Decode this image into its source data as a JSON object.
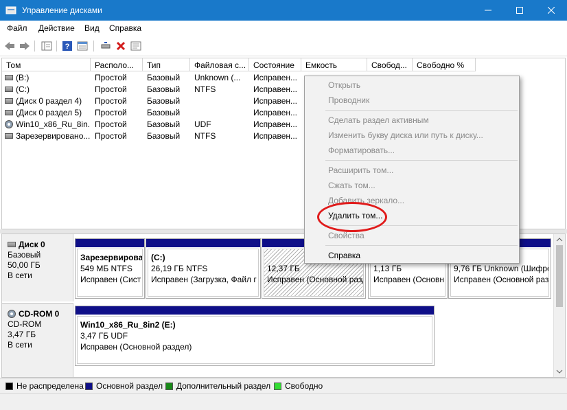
{
  "window": {
    "title": "Управление дисками"
  },
  "menu": {
    "file": "Файл",
    "action": "Действие",
    "view": "Вид",
    "help": "Справка"
  },
  "columns": [
    "Том",
    "Располо...",
    "Тип",
    "Файловая с...",
    "Состояние",
    "Емкость",
    "Свобод...",
    "Свободно %"
  ],
  "volumes": [
    {
      "name": "(B:)",
      "layout": "Простой",
      "type": "Базовый",
      "fs": "Unknown (...",
      "status": "Исправен..."
    },
    {
      "name": "(C:)",
      "layout": "Простой",
      "type": "Базовый",
      "fs": "NTFS",
      "status": "Исправен..."
    },
    {
      "name": "(Диск 0 раздел 4)",
      "layout": "Простой",
      "type": "Базовый",
      "fs": "",
      "status": "Исправен..."
    },
    {
      "name": "(Диск 0 раздел 5)",
      "layout": "Простой",
      "type": "Базовый",
      "fs": "",
      "status": "Исправен..."
    },
    {
      "name": "Win10_x86_Ru_8in...",
      "layout": "Простой",
      "type": "Базовый",
      "fs": "UDF",
      "status": "Исправен..."
    },
    {
      "name": "Зарезервировано...",
      "layout": "Простой",
      "type": "Базовый",
      "fs": "NTFS",
      "status": "Исправен..."
    }
  ],
  "disks": [
    {
      "name": "Диск 0",
      "kind": "Базовый",
      "size": "50,00 ГБ",
      "state": "В сети",
      "partitions": [
        {
          "title": "Зарезервирова",
          "size": "549 МБ NTFS",
          "status": "Исправен (Сист"
        },
        {
          "title": "(C:)",
          "size": "26,19 ГБ NTFS",
          "status": "Исправен (Загрузка, Файл г"
        },
        {
          "title": "",
          "size": "12,37 ГБ",
          "status": "Исправен (Основной разд"
        },
        {
          "title": "",
          "size": "1,13 ГБ",
          "status": "Исправен (Основн"
        },
        {
          "title": "",
          "size": "9,76 ГБ Unknown (Шифро",
          "status": "Исправен (Основной раздел"
        }
      ]
    },
    {
      "name": "CD-ROM 0",
      "kind": "CD-ROM",
      "size": "3,47 ГБ",
      "state": "В сети",
      "partitions": [
        {
          "title": "Win10_x86_Ru_8in2  (E:)",
          "size": "3,47 ГБ UDF",
          "status": "Исправен (Основной раздел)"
        }
      ]
    }
  ],
  "legend": [
    {
      "label": "Не распределена",
      "color": "#000000"
    },
    {
      "label": "Основной раздел",
      "color": "#0f0f88"
    },
    {
      "label": "Дополнительный раздел",
      "color": "#1a8a1a"
    },
    {
      "label": "Свободно",
      "color": "#33dd33"
    }
  ],
  "context_menu": {
    "open": "Открыть",
    "explorer": "Проводник",
    "mark_active": "Сделать раздел активным",
    "change_letter": "Изменить букву диска или путь к диску...",
    "format": "Форматировать...",
    "extend": "Расширить том...",
    "shrink": "Сжать том...",
    "add_mirror": "Добавить зеркало...",
    "delete": "Удалить том...",
    "properties": "Свойства",
    "help": "Справка"
  },
  "colors": {
    "titlebar": "#1979ca",
    "primary_partition": "#0f0f88",
    "highlight": "#e01b1b"
  }
}
